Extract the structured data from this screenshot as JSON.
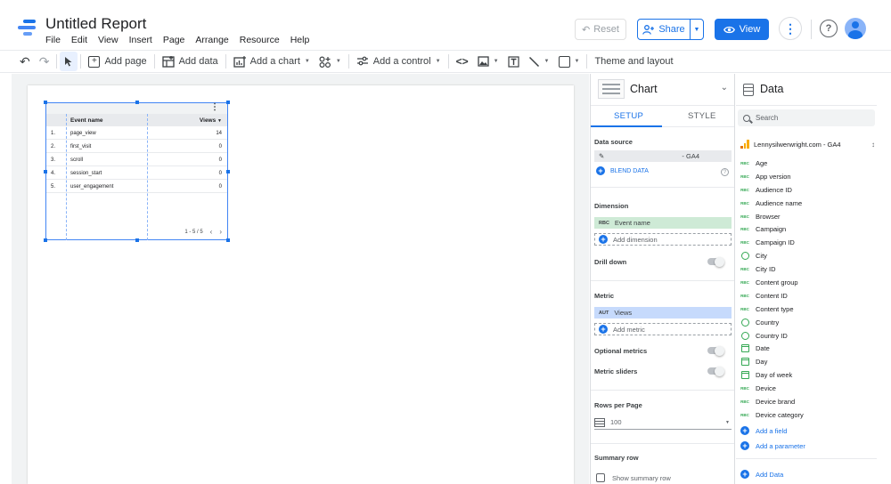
{
  "header": {
    "title": "Untitled Report",
    "menu": [
      "File",
      "Edit",
      "View",
      "Insert",
      "Page",
      "Arrange",
      "Resource",
      "Help"
    ],
    "reset_label": "Reset",
    "share_label": "Share",
    "view_label": "View"
  },
  "toolbar": {
    "add_page": "Add page",
    "add_data": "Add data",
    "add_chart": "Add a chart",
    "add_control": "Add a control",
    "theme_layout": "Theme and layout"
  },
  "table": {
    "columns": [
      "Event name",
      "Views"
    ],
    "rows": [
      {
        "idx": "1.",
        "name": "page_view",
        "value": "14"
      },
      {
        "idx": "2.",
        "name": "first_visit",
        "value": "0"
      },
      {
        "idx": "3.",
        "name": "scroll",
        "value": "0"
      },
      {
        "idx": "4.",
        "name": "session_start",
        "value": "0"
      },
      {
        "idx": "5.",
        "name": "user_engagement",
        "value": "0"
      }
    ],
    "pagination": "1 - 5 / 5"
  },
  "chart_panel": {
    "title": "Chart",
    "tab_setup": "SETUP",
    "tab_style": "STYLE",
    "data_source_label": "Data source",
    "data_source_value": "- GA4",
    "blend_data": "BLEND DATA",
    "dimension_label": "Dimension",
    "dimension_value": "Event name",
    "dimension_badge": "RBC",
    "add_dimension": "Add dimension",
    "drill_down": "Drill down",
    "metric_label": "Metric",
    "metric_value": "Views",
    "metric_badge": "AUT",
    "add_metric": "Add metric",
    "optional_metrics": "Optional metrics",
    "metric_sliders": "Metric sliders",
    "rows_per_page_label": "Rows per Page",
    "rows_per_page_value": "100",
    "summary_row_label": "Summary row",
    "show_summary_row": "Show summary row"
  },
  "data_panel": {
    "title": "Data",
    "search_placeholder": "Search",
    "source_name": "Lennysilwerwright.com - GA4",
    "fields": [
      {
        "type": "text",
        "label": "Age"
      },
      {
        "type": "text",
        "label": "App version"
      },
      {
        "type": "text",
        "label": "Audience ID"
      },
      {
        "type": "text",
        "label": "Audience name"
      },
      {
        "type": "text",
        "label": "Browser"
      },
      {
        "type": "text",
        "label": "Campaign"
      },
      {
        "type": "text",
        "label": "Campaign ID"
      },
      {
        "type": "geo",
        "label": "City"
      },
      {
        "type": "text",
        "label": "City ID"
      },
      {
        "type": "text",
        "label": "Content group"
      },
      {
        "type": "text",
        "label": "Content ID"
      },
      {
        "type": "text",
        "label": "Content type"
      },
      {
        "type": "geo",
        "label": "Country"
      },
      {
        "type": "geo",
        "label": "Country ID"
      },
      {
        "type": "date",
        "label": "Date"
      },
      {
        "type": "date",
        "label": "Day"
      },
      {
        "type": "date",
        "label": "Day of week"
      },
      {
        "type": "text",
        "label": "Device"
      },
      {
        "type": "text",
        "label": "Device brand"
      },
      {
        "type": "text",
        "label": "Device category"
      }
    ],
    "text_badge": "RBC",
    "add_field": "Add a field",
    "add_parameter": "Add a parameter",
    "add_data": "Add Data"
  },
  "colors": {
    "accent": "#1a73e8",
    "dimension_green": "#ceead6",
    "metric_blue": "#c6dafc"
  }
}
